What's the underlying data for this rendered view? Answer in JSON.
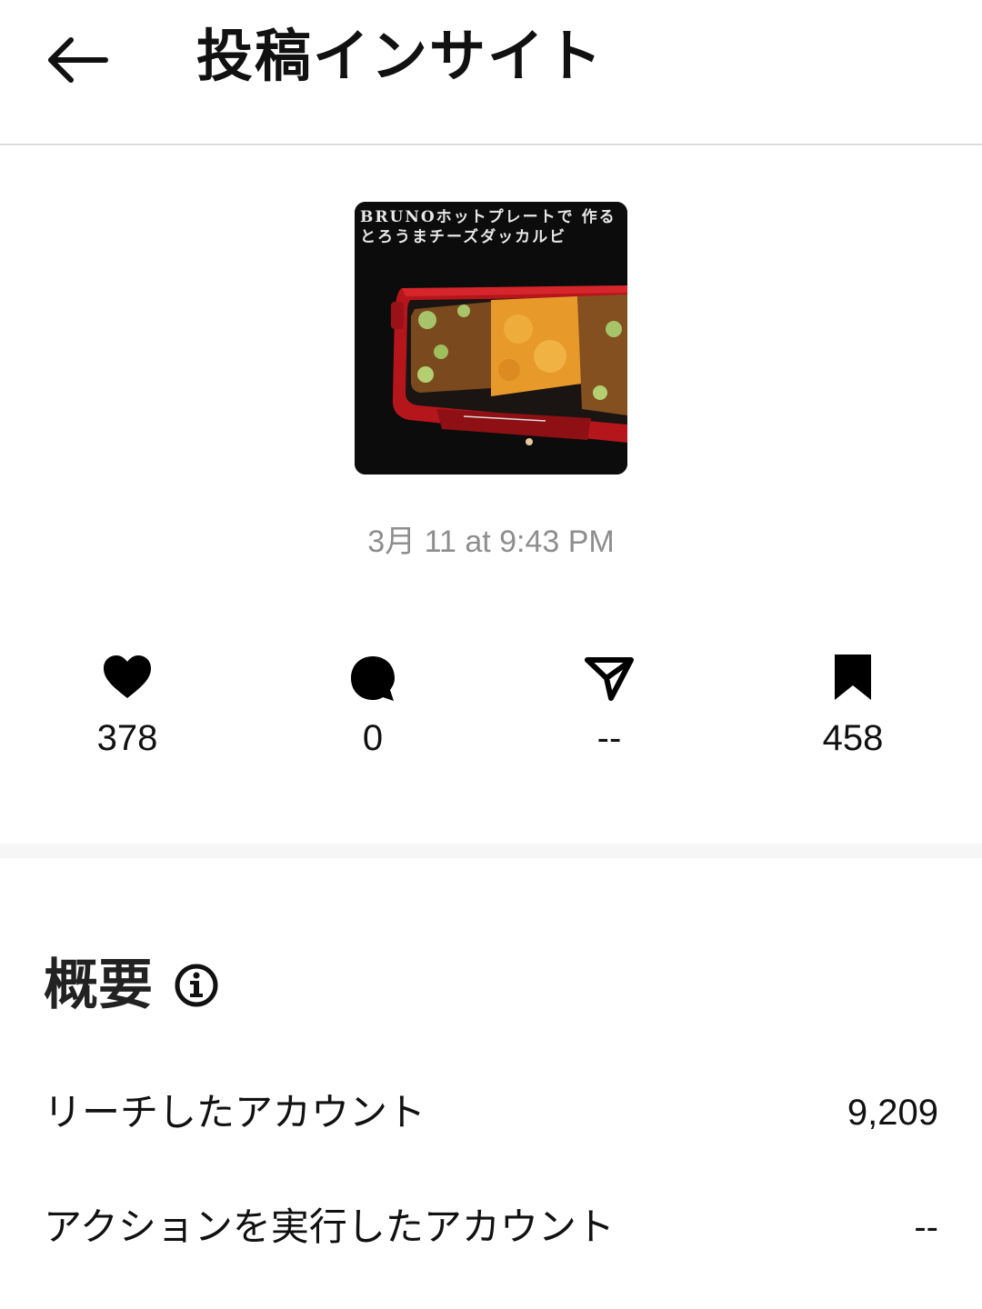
{
  "header": {
    "title": "投稿インサイト",
    "back_icon": "arrow-left-icon"
  },
  "post": {
    "thumbnail_caption_line1": "BRUNOホットプレートで 作る",
    "thumbnail_caption_line2": "とろうまチーズダッカルビ",
    "date": "3月 11 at 9:43 PM"
  },
  "stats": [
    {
      "icon": "heart-icon",
      "value": "378"
    },
    {
      "icon": "comment-icon",
      "value": "0"
    },
    {
      "icon": "send-icon",
      "value": "--"
    },
    {
      "icon": "bookmark-icon",
      "value": "458"
    }
  ],
  "overview": {
    "title": "概要",
    "info_icon": "info-icon",
    "metrics": [
      {
        "label": "リーチしたアカウント",
        "value": "9,209"
      },
      {
        "label": "アクションを実行したアカウント",
        "value": "--"
      }
    ]
  },
  "colors": {
    "text_primary": "#111111",
    "text_secondary": "#8e8e8e",
    "divider": "#dcdcdc",
    "band": "#f6f6f6"
  }
}
